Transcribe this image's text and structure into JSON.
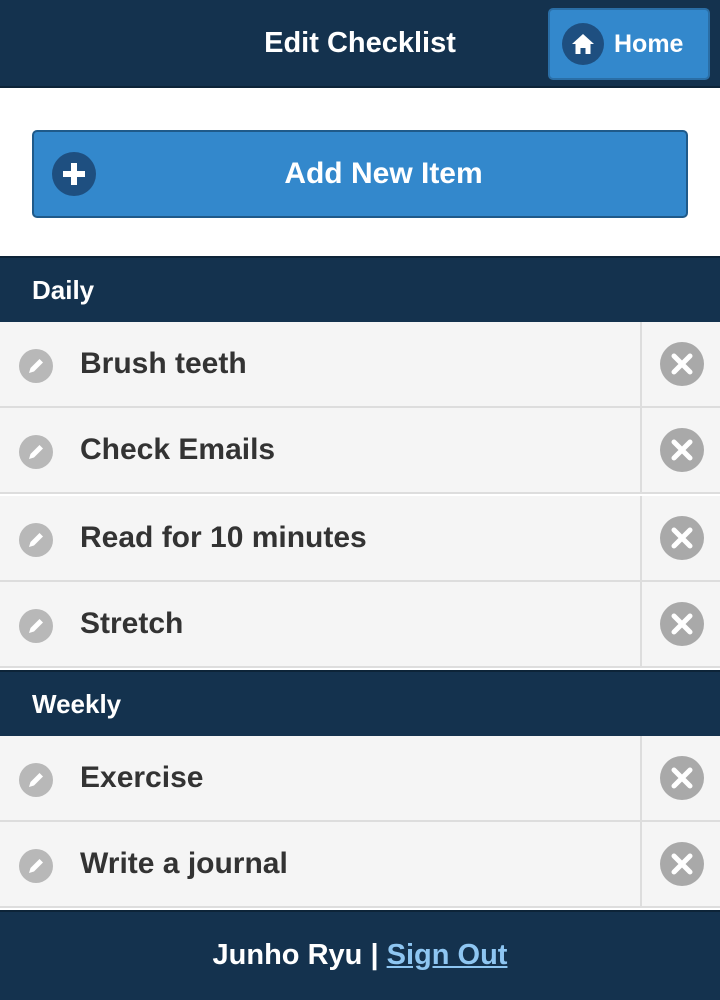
{
  "header": {
    "title": "Edit Checklist",
    "home_label": "Home"
  },
  "add_item": {
    "label": "Add New Item"
  },
  "sections": [
    {
      "title": "Daily",
      "items": [
        {
          "label": "Brush teeth"
        },
        {
          "label": "Check Emails"
        },
        {
          "label": "Read for 10 minutes"
        },
        {
          "label": "Stretch"
        }
      ]
    },
    {
      "title": "Weekly",
      "items": [
        {
          "label": "Exercise"
        },
        {
          "label": "Write a journal"
        }
      ]
    }
  ],
  "footer": {
    "user_name": "Junho Ryu",
    "separator": "|",
    "signout_label": "Sign Out"
  },
  "icons": {
    "home": "home-icon",
    "add": "plus-icon",
    "edit": "pencil-icon",
    "delete": "close-icon"
  },
  "colors": {
    "bar": "#14324e",
    "button": "#3388cc",
    "row_bg": "#f5f5f5",
    "link": "#8ec6f2"
  }
}
